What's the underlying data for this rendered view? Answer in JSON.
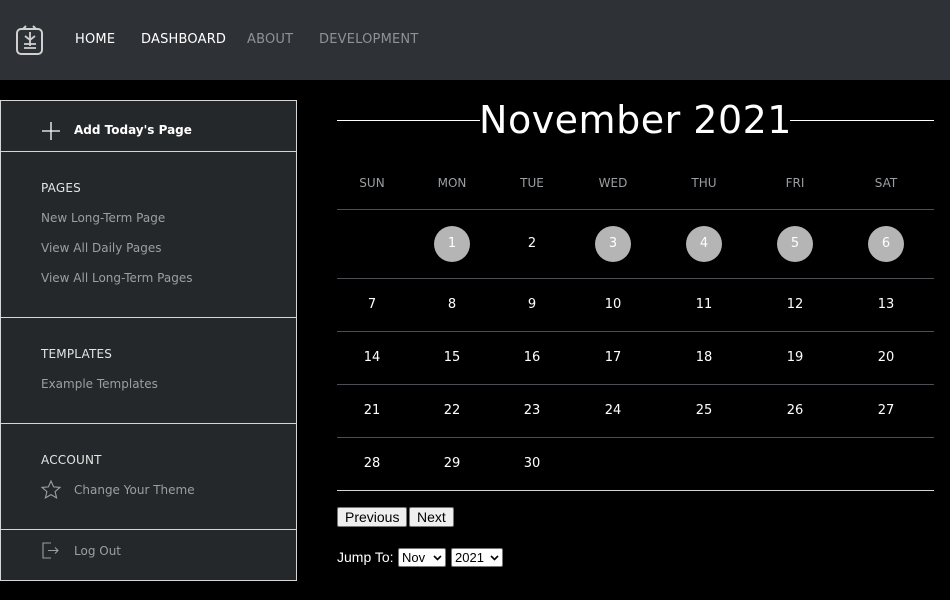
{
  "nav": {
    "items": [
      {
        "label": "HOME"
      },
      {
        "label": "DASHBOARD"
      },
      {
        "label": "ABOUT"
      },
      {
        "label": "DEVELOPMENT"
      }
    ]
  },
  "sidebar": {
    "add_label": "Add Today's Page",
    "pages": {
      "heading": "PAGES",
      "items": [
        "New Long-Term Page",
        "View All Daily Pages",
        "View All Long-Term Pages"
      ]
    },
    "templates": {
      "heading": "TEMPLATES",
      "items": [
        "Example Templates"
      ]
    },
    "account": {
      "heading": "ACCOUNT",
      "items": [
        "Change Your Theme"
      ]
    },
    "logout_label": "Log Out"
  },
  "calendar": {
    "title": "November 2021",
    "weekdays": [
      "SUN",
      "MON",
      "TUE",
      "WED",
      "THU",
      "FRI",
      "SAT"
    ],
    "days": [
      "1",
      "2",
      "3",
      "4",
      "5",
      "6",
      "7",
      "8",
      "9",
      "10",
      "11",
      "12",
      "13",
      "14",
      "15",
      "16",
      "17",
      "18",
      "19",
      "20",
      "21",
      "22",
      "23",
      "24",
      "25",
      "26",
      "27",
      "28",
      "29",
      "30"
    ],
    "marked_days": [
      "1",
      "3",
      "4",
      "5",
      "6"
    ]
  },
  "controls": {
    "previous_label": "Previous",
    "next_label": "Next",
    "jump_label": "Jump To:",
    "month_value": "Nov",
    "year_value": "2021"
  },
  "colors": {
    "topbar": "#2e3135",
    "sidebar": "#25282b",
    "marked_day": "#b5b5b5",
    "background": "#000000"
  },
  "icons": [
    "logo-icon",
    "plus-icon",
    "star-icon",
    "logout-icon",
    "chevron-down-icon"
  ]
}
